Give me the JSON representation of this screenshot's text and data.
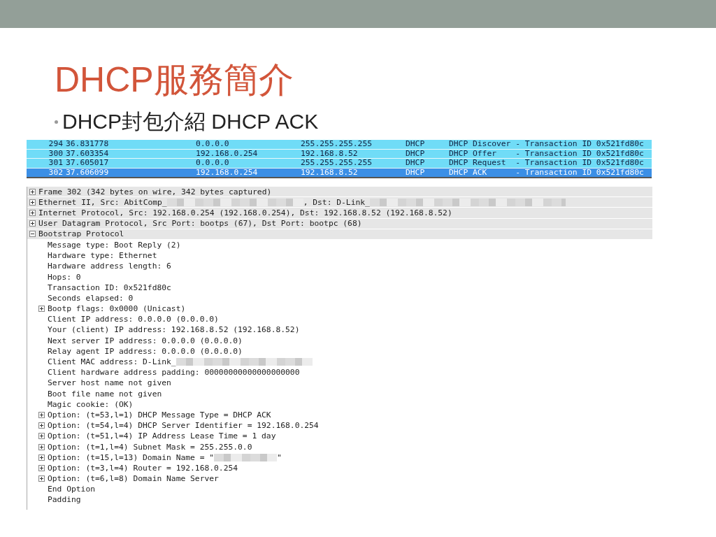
{
  "slide": {
    "title": "DHCP服務簡介",
    "subtitle": "DHCP封包介紹 DHCP ACK"
  },
  "packet_list": {
    "rows": [
      {
        "column_1": "294",
        "column_2": "36.831778",
        "column_3": "0.0.0.0",
        "column_4": "255.255.255.255",
        "column_5": "DHCP",
        "column_6": "DHCP Discover - Transaction ID 0x521fd80c",
        "selected": false
      },
      {
        "column_1": "300",
        "column_2": "37.603354",
        "column_3": "192.168.0.254",
        "column_4": "192.168.8.52",
        "column_5": "DHCP",
        "column_6": "DHCP Offer    - Transaction ID 0x521fd80c",
        "selected": false
      },
      {
        "column_1": "301",
        "column_2": "37.605017",
        "column_3": "0.0.0.0",
        "column_4": "255.255.255.255",
        "column_5": "DHCP",
        "column_6": "DHCP Request  - Transaction ID 0x521fd80c",
        "selected": false
      },
      {
        "column_1": "302",
        "column_2": "37.606099",
        "column_3": "192.168.0.254",
        "column_4": "192.168.8.52",
        "column_5": "DHCP",
        "column_6": "DHCP ACK      - Transaction ID 0x521fd80c",
        "selected": true
      }
    ]
  },
  "packet_details": {
    "items": [
      {
        "kind": "branch",
        "expanded": false,
        "text": "Frame 302 (342 bytes on wire, 342 bytes captured)"
      },
      {
        "kind": "branch",
        "expanded": false,
        "segments": [
          {
            "kind": "text",
            "text": "Ethernet II, Src: AbitComp_"
          },
          {
            "kind": "blur_medium"
          },
          {
            "kind": "text",
            "text": ", Dst: D-Link_"
          },
          {
            "kind": "blur_long"
          }
        ]
      },
      {
        "kind": "branch",
        "expanded": false,
        "text": "Internet Protocol, Src: 192.168.0.254 (192.168.0.254), Dst: 192.168.8.52 (192.168.8.52)"
      },
      {
        "kind": "branch",
        "expanded": false,
        "text": "User Datagram Protocol, Src Port: bootps (67), Dst Port: bootpc (68)"
      },
      {
        "kind": "branch",
        "expanded": true,
        "text": "Bootstrap Protocol",
        "children": [
          {
            "kind": "leaf",
            "text": "Message type: Boot Reply (2)"
          },
          {
            "kind": "leaf",
            "text": "Hardware type: Ethernet"
          },
          {
            "kind": "leaf",
            "text": "Hardware address length: 6"
          },
          {
            "kind": "leaf",
            "text": "Hops: 0"
          },
          {
            "kind": "leaf",
            "text": "Transaction ID: 0x521fd80c"
          },
          {
            "kind": "leaf",
            "text": "Seconds elapsed: 0"
          },
          {
            "kind": "branch",
            "expanded": false,
            "text": "Bootp flags: 0x0000 (Unicast)"
          },
          {
            "kind": "leaf",
            "text": "Client IP address: 0.0.0.0 (0.0.0.0)"
          },
          {
            "kind": "leaf",
            "text": "Your (client) IP address: 192.168.8.52 (192.168.8.52)"
          },
          {
            "kind": "leaf",
            "text": "Next server IP address: 0.0.0.0 (0.0.0.0)"
          },
          {
            "kind": "leaf",
            "text": "Relay agent IP address: 0.0.0.0 (0.0.0.0)"
          },
          {
            "kind": "leaf",
            "segments": [
              {
                "kind": "text",
                "text": "Client MAC address: D-Link_"
              },
              {
                "kind": "blur_medium"
              }
            ]
          },
          {
            "kind": "leaf",
            "text": "Client hardware address padding: 00000000000000000000"
          },
          {
            "kind": "leaf",
            "text": "Server host name not given"
          },
          {
            "kind": "leaf",
            "text": "Boot file name not given"
          },
          {
            "kind": "leaf",
            "text": "Magic cookie: (OK)"
          },
          {
            "kind": "branch",
            "expanded": false,
            "text": "Option: (t=53,l=1) DHCP Message Type = DHCP ACK"
          },
          {
            "kind": "branch",
            "expanded": false,
            "text": "Option: (t=54,l=4) DHCP Server Identifier = 192.168.0.254"
          },
          {
            "kind": "branch",
            "expanded": false,
            "text": "Option: (t=51,l=4) IP Address Lease Time = 1 day"
          },
          {
            "kind": "branch",
            "expanded": false,
            "text": "Option: (t=1,l=4) Subnet Mask = 255.255.0.0"
          },
          {
            "kind": "branch",
            "expanded": false,
            "segments": [
              {
                "kind": "text",
                "text": "Option: (t=15,l=13) Domain Name = \""
              },
              {
                "kind": "blur_short"
              },
              {
                "kind": "text",
                "text": "\""
              }
            ]
          },
          {
            "kind": "branch",
            "expanded": false,
            "text": "Option: (t=3,l=4) Router = 192.168.0.254"
          },
          {
            "kind": "branch",
            "expanded": false,
            "text": "Option: (t=6,l=8) Domain Name Server"
          },
          {
            "kind": "leaf",
            "text": "End Option"
          },
          {
            "kind": "leaf",
            "text": "Padding"
          }
        ]
      }
    ]
  }
}
